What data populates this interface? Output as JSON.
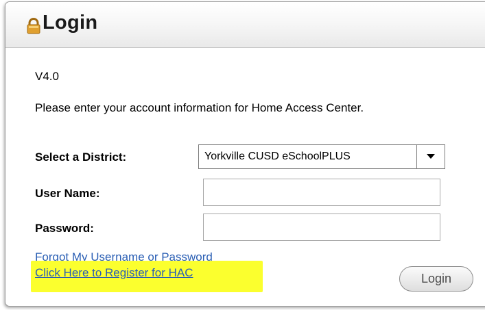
{
  "header": {
    "title": "Login",
    "icon": "lock-icon"
  },
  "form": {
    "version": "V4.0",
    "intro": "Please enter your account information for Home Access Center.",
    "district": {
      "label": "Select a District:",
      "value": "Yorkville CUSD eSchoolPLUS"
    },
    "username": {
      "label": "User Name:",
      "value": ""
    },
    "password": {
      "label": "Password:",
      "value": ""
    }
  },
  "links": {
    "forgot": "Forgot My Username or Password",
    "register": "Click Here to Register for HAC"
  },
  "buttons": {
    "login": "Login"
  },
  "colors": {
    "link": "#2b5fb4",
    "highlight": "#fbff2e",
    "lock_body": "#e0a030"
  }
}
